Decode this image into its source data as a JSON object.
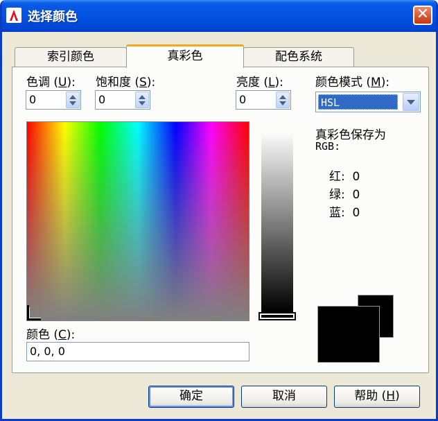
{
  "window": {
    "title": "选择颜色"
  },
  "tabs": [
    {
      "label": "索引颜色"
    },
    {
      "label": "真彩色"
    },
    {
      "label": "配色系统"
    }
  ],
  "hue": {
    "label_prefix": "色调 (",
    "key": "U",
    "label_suffix": "):",
    "value": "0"
  },
  "saturation": {
    "label_prefix": "饱和度 (",
    "key": "S",
    "label_suffix": "):",
    "value": "0"
  },
  "luminance": {
    "label_prefix": "亮度 (",
    "key": "L",
    "label_suffix": "):",
    "value": "0"
  },
  "color_model": {
    "label_prefix": "颜色模式 (",
    "key": "M",
    "label_suffix": "):",
    "selected": "HSL"
  },
  "true_color_saved_as": {
    "line1": "真彩色保存为",
    "line2": "RGB:"
  },
  "rgb": {
    "red": {
      "label": "红:",
      "value": "0"
    },
    "green": {
      "label": "绿:",
      "value": "0"
    },
    "blue": {
      "label": "蓝:",
      "value": "0"
    }
  },
  "color_field": {
    "label_prefix": "颜色 (",
    "key": "C",
    "label_suffix": "):",
    "value": "0, 0, 0"
  },
  "buttons": {
    "ok": "确定",
    "cancel": "取消",
    "help_prefix": "帮助 (",
    "help_key": "H",
    "help_suffix": ")"
  },
  "colors": {
    "title_bar": "#0453e1",
    "dialog_bg": "#ece9d8",
    "selection": "#316ac5",
    "active_tab_accent": "#f5a623",
    "current_color": "#000000",
    "close_button": "#d6542f"
  },
  "icons": {
    "app": "autocad-icon",
    "close": "close-icon",
    "spin": "spin-arrows-icon",
    "dropdown": "chevron-down-icon",
    "picker": "crosshair-icon"
  }
}
